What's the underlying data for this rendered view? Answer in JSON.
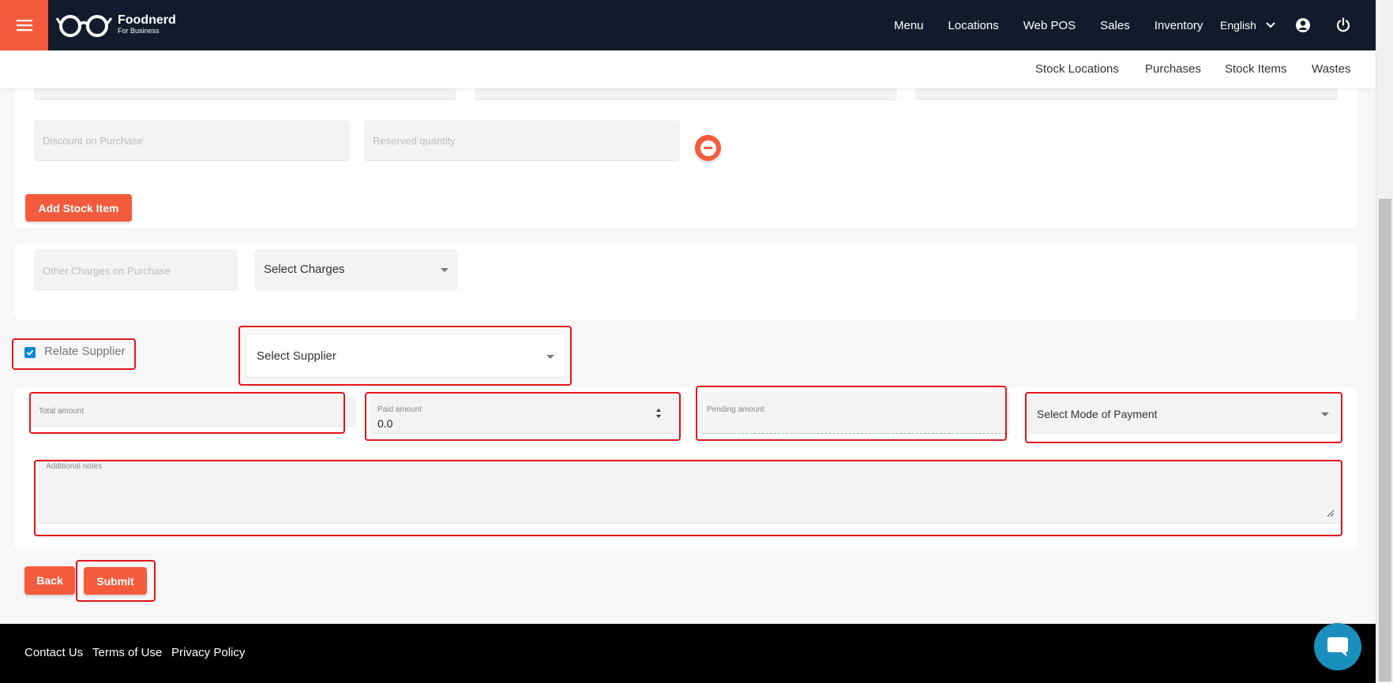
{
  "colors": {
    "accent": "#f45b3c",
    "topbar": "#121a2c",
    "highlight": "#e4141b",
    "checkbox": "#0a8bd6",
    "chat": "#1a8fbd"
  },
  "brand": {
    "name": "Foodnerd",
    "tagline": "For Business"
  },
  "topnav": {
    "menu": "Menu",
    "locations": "Locations",
    "web_pos": "Web POS",
    "sales": "Sales",
    "inventory": "Inventory",
    "language": "English"
  },
  "subnav": {
    "stock_locations": "Stock Locations",
    "purchases": "Purchases",
    "stock_items": "Stock Items",
    "wastes": "Wastes"
  },
  "stock_item": {
    "discount_placeholder": "Discount on Purchase",
    "reserved_placeholder": "Reserved quantity",
    "add_button": "Add Stock Item"
  },
  "charges": {
    "other_charges_placeholder": "Other Charges on Purchase",
    "select_charges": "Select Charges"
  },
  "supplier": {
    "relate_label": "Relate Supplier",
    "relate_checked": true,
    "select_supplier": "Select Supplier"
  },
  "payment": {
    "total_label": "Total amount",
    "paid_label": "Paid amount",
    "paid_value": "0.0",
    "pending_label": "Pending amount",
    "mode_select": "Select Mode of Payment",
    "notes_label": "Additional notes"
  },
  "actions": {
    "back": "Back",
    "submit": "Submit"
  },
  "footer": {
    "contact": "Contact Us",
    "terms": "Terms of Use",
    "privacy": "Privacy Policy"
  }
}
